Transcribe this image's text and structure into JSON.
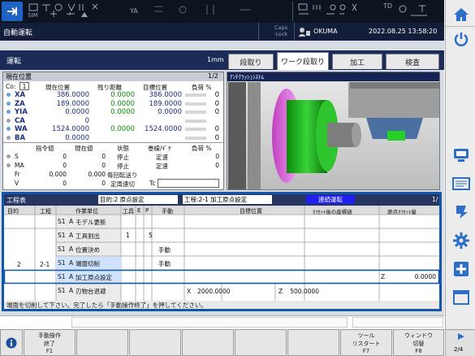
{
  "top": {
    "status_left": "SIM",
    "status_mid": "YA",
    "status_right": "TD",
    "mode_title": "自動運転",
    "caps_lock": "Caps\nLock",
    "user": "OKUMA",
    "datetime": "2022.08.25 13:58:20"
  },
  "operation": {
    "title": "運転",
    "unit": "1mm",
    "tabs": [
      "段取り",
      "ワーク段取り",
      "加工",
      "検査"
    ],
    "active_tab_index": 1
  },
  "position_panel": {
    "title": "現在位置",
    "page": "1/2",
    "co_label": "Co:",
    "co_value": "1",
    "headers": [
      "現在位置",
      "残り距離",
      "目標位置",
      "負荷 %"
    ],
    "axes": [
      {
        "name": "XA",
        "current": "386.0000",
        "remaining": "0.0000",
        "target": "386.0000",
        "load": "0"
      },
      {
        "name": "ZA",
        "current": "189.0000",
        "remaining": "0.0000",
        "target": "189.0000",
        "load": "0"
      },
      {
        "name": "YIA",
        "current": "0.0000",
        "remaining": "0.0000",
        "target": "0.0000",
        "load": "0"
      },
      {
        "name": "CA",
        "current": "0",
        "remaining": "",
        "target": "",
        "load": ""
      },
      {
        "name": "WA",
        "current": "1524.0000",
        "remaining": "0.0000",
        "target": "1524.0000",
        "load": "0"
      },
      {
        "name": "BA",
        "current": "0.0000",
        "remaining": "",
        "target": "",
        "load": "0"
      }
    ],
    "headers2": [
      "指令値",
      "現在値",
      "状態",
      "巻線/ｷﾞﾔ",
      "負荷 %"
    ],
    "spindles": [
      {
        "name": "S",
        "command": "0",
        "current": "0",
        "state": "停止",
        "gear": "定速",
        "load": "0"
      },
      {
        "name": "MA",
        "command": "0",
        "current": "0",
        "state": "停止",
        "gear": "定速",
        "load": "0"
      }
    ],
    "fr_label": "Fr",
    "fr_command": "0.000",
    "fr_current": "0.000",
    "fr_state": "毎回転送り",
    "v_label": "V",
    "v_command": "0",
    "v_current": "0",
    "v_state": "定周速切",
    "tc_label": "Tc"
  },
  "animation": {
    "title": "ｱﾝﾁｸﾗｯｼｭｼｽﾃﾑ"
  },
  "process": {
    "title": "工程表",
    "target": "目的:2 原点設定",
    "step": "工程:2-1 加工原点設定",
    "status": "連続運転",
    "page": "1/",
    "columns": [
      "目的",
      "工程",
      "作業単位",
      "工具",
      "E",
      "P",
      "手動",
      "目標位置",
      "ｵﾌｾｯﾄ後の座標値",
      "原点ｵﾌｾｯﾄ量"
    ],
    "purpose": "2",
    "process_no": "2-1",
    "rows": [
      {
        "s": "S1",
        "a": "A",
        "unit": "モデル更新",
        "tool": "",
        "e": "",
        "manual": ""
      },
      {
        "s": "S1",
        "a": "A",
        "unit": "工具割出",
        "tool": "1",
        "e": "5",
        "manual": ""
      },
      {
        "s": "S1",
        "a": "A",
        "unit": "位置決め",
        "tool": "",
        "e": "",
        "manual": "手動"
      },
      {
        "s": "S1",
        "a": "A",
        "unit": "端面切削",
        "tool": "",
        "e": "",
        "manual": "手動"
      },
      {
        "s": "S1",
        "a": "A",
        "unit": "加工原点設定",
        "tool": "",
        "e": "",
        "manual": ""
      },
      {
        "s": "S1",
        "a": "A",
        "unit": "刃物台退避",
        "tool": "",
        "e": "",
        "manual": ""
      }
    ],
    "origin_axis": "Z",
    "origin_value": "0.0000",
    "retract_x_label": "X",
    "retract_x": "2000.0000",
    "retract_z_label": "Z",
    "retract_z": "500.0000",
    "message": "端面を切削して下さい。完了したら「手動操作終了」を押してください。"
  },
  "softkeys": {
    "f1_top": "手動操作",
    "f1_mid": "終了",
    "f1": "F1",
    "f7_top": "ツール",
    "f7_mid": "リスタート",
    "f7": "F7",
    "f8_top": "ウィンドウ",
    "f8_mid": "切替",
    "f8": "F8",
    "page": "2/4"
  },
  "colors": {
    "accent_blue": "#1356a7",
    "value_green": "#0a8a0a",
    "header_navy": "#1c2c58"
  }
}
